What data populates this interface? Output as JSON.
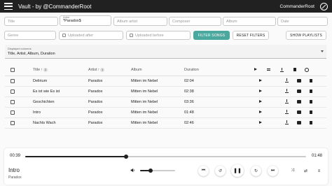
{
  "app": {
    "title": "Vault - by @CommanderRoot",
    "user": "CommanderRoot"
  },
  "filters": {
    "title": {
      "placeholder": "Title"
    },
    "artist": {
      "label": "Artist",
      "value": "*Paradox$"
    },
    "album_artist": {
      "placeholder": "Album artist"
    },
    "composer": {
      "placeholder": "Composer"
    },
    "album": {
      "placeholder": "Album"
    },
    "date": {
      "placeholder": "Date"
    },
    "genre": {
      "placeholder": "Genre"
    },
    "uploaded_after": {
      "placeholder": "Uploaded after"
    },
    "uploaded_before": {
      "placeholder": "Uploaded before"
    },
    "filter_button": "Filter songs",
    "reset_button": "Reset filters",
    "playlists_button": "Show playlists"
  },
  "columns_select": {
    "label": "Displayed columns",
    "value": "Title, Artist, Album, Duration"
  },
  "table": {
    "headers": {
      "title": "Title",
      "artist": "Artist",
      "album": "Album",
      "duration": "Duration"
    },
    "sort": {
      "title_order": "2",
      "artist_order": "1"
    },
    "rows": [
      {
        "title": "Delirium",
        "artist": "Paradox",
        "album": "Mitten im Nebel",
        "duration": "02:04"
      },
      {
        "title": "Es ist wie Es ist",
        "artist": "Paradox",
        "album": "Mitten im Nebel",
        "duration": "02:38"
      },
      {
        "title": "Geschichten",
        "artist": "Paradox",
        "album": "Mitten im Nebel",
        "duration": "03:36"
      },
      {
        "title": "Intro",
        "artist": "Paradox",
        "album": "Mitten im Nebel",
        "duration": "01:48"
      },
      {
        "title": "Nachts Wach",
        "artist": "Paradox",
        "album": "Mitten im Nebel",
        "duration": "02:46"
      }
    ]
  },
  "player": {
    "current_time": "00:39",
    "total_time": "01:48",
    "progress_fraction": 0.36,
    "volume_fraction": 0.3,
    "track_title": "Intro",
    "track_artist": "Paradox"
  },
  "colors": {
    "appbar": "#212121",
    "accent": "#4aa89f"
  }
}
